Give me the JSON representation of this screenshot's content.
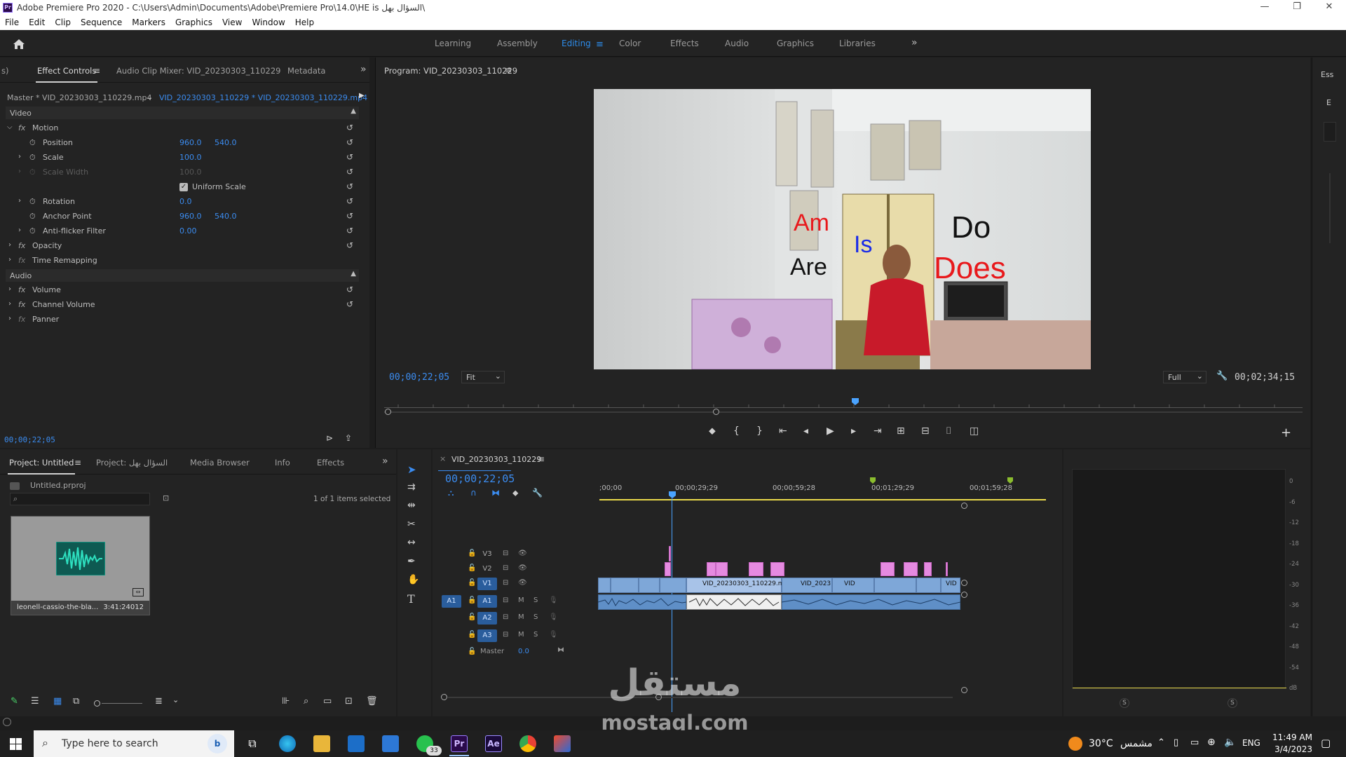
{
  "window": {
    "title": "Adobe Premiere Pro 2020 - C:\\Users\\Admin\\Documents\\Adobe\\Premiere Pro\\14.0\\HE is  السؤال بهل\\",
    "minimize": "—",
    "maximize": "❐",
    "close": "✕"
  },
  "menu": [
    "File",
    "Edit",
    "Clip",
    "Sequence",
    "Markers",
    "Graphics",
    "View",
    "Window",
    "Help"
  ],
  "workspaces": [
    "Learning",
    "Assembly",
    "Editing",
    "Color",
    "Effects",
    "Audio",
    "Graphics",
    "Libraries"
  ],
  "workspace_active": "Editing",
  "effect_controls": {
    "tabs": [
      "s)",
      "Effect Controls",
      "Audio Clip Mixer: VID_20230303_110229",
      "Metadata"
    ],
    "source": "Master * VID_20230303_110229.mp4",
    "target": "VID_20230303_110229 * VID_20230303_110229.mp4",
    "video_label": "Video",
    "audio_label": "Audio",
    "motion": "Motion",
    "position_label": "Position",
    "position_x": "960.0",
    "position_y": "540.0",
    "scale_label": "Scale",
    "scale": "100.0",
    "scale_width_label": "Scale Width",
    "scale_width": "100.0",
    "uniform_scale": "Uniform Scale",
    "rotation_label": "Rotation",
    "rotation": "0.0",
    "anchor_label": "Anchor Point",
    "anchor_x": "960.0",
    "anchor_y": "540.0",
    "antiflicker_label": "Anti-flicker Filter",
    "antiflicker": "0.00",
    "opacity": "Opacity",
    "time_remap": "Time Remapping",
    "volume": "Volume",
    "channel_volume": "Channel Volume",
    "panner": "Panner",
    "timecode": "00;00;22;05"
  },
  "program": {
    "title": "Program: VID_20230303_110229",
    "timecode": "00;00;22;05",
    "fit": "Fit",
    "quality": "Full",
    "duration": "00;02;34;15",
    "overlay_words": {
      "am": "Am",
      "is": "Is",
      "do": "Do",
      "are": "Are",
      "does": "Does"
    }
  },
  "project": {
    "tabs": [
      "Project: Untitled",
      "Project: السؤال بهل",
      "Media Browser",
      "Info",
      "Effects"
    ],
    "file": "Untitled.prproj",
    "selected": "1 of 1 items selected",
    "item_name": "leonell-cassio-the-bla...",
    "item_duration": "3:41:24012"
  },
  "timeline": {
    "title": "VID_20230303_110229",
    "timecode": "00;00;22;05",
    "ruler": [
      ";00;00",
      "00;00;29;29",
      "00;00;59;28",
      "00;01;29;29",
      "00;01;59;28"
    ],
    "tracks_video": [
      "V3",
      "V2",
      "V1"
    ],
    "tracks_audio": [
      "A1",
      "A2",
      "A3"
    ],
    "src_patch": "A1",
    "master": "Master",
    "master_value": "0.0",
    "clip_label_main": "VID_20230303_110229.mp4 [V]",
    "clip_label_2": "VID_2023",
    "clip_label_3": "VID",
    "clip_label_4": "VID"
  },
  "meters": {
    "scale": [
      "0",
      "-6",
      "-12",
      "-18",
      "-24",
      "-30",
      "-36",
      "-42",
      "-48",
      "-54",
      "dB"
    ],
    "s1": "S",
    "s2": "S"
  },
  "essentials": {
    "label": "Ess",
    "letter": "E"
  },
  "taskbar": {
    "search": "Type here to search",
    "weather": "30°C",
    "weather_label": "مشمس",
    "lang": "ENG",
    "time": "11:49 AM",
    "date": "3/4/2023",
    "whatsapp_badge": "33",
    "pr": "Pr",
    "ae": "Ae"
  },
  "watermark": {
    "arabic": "مستقل",
    "latin": "mostaql.com"
  }
}
